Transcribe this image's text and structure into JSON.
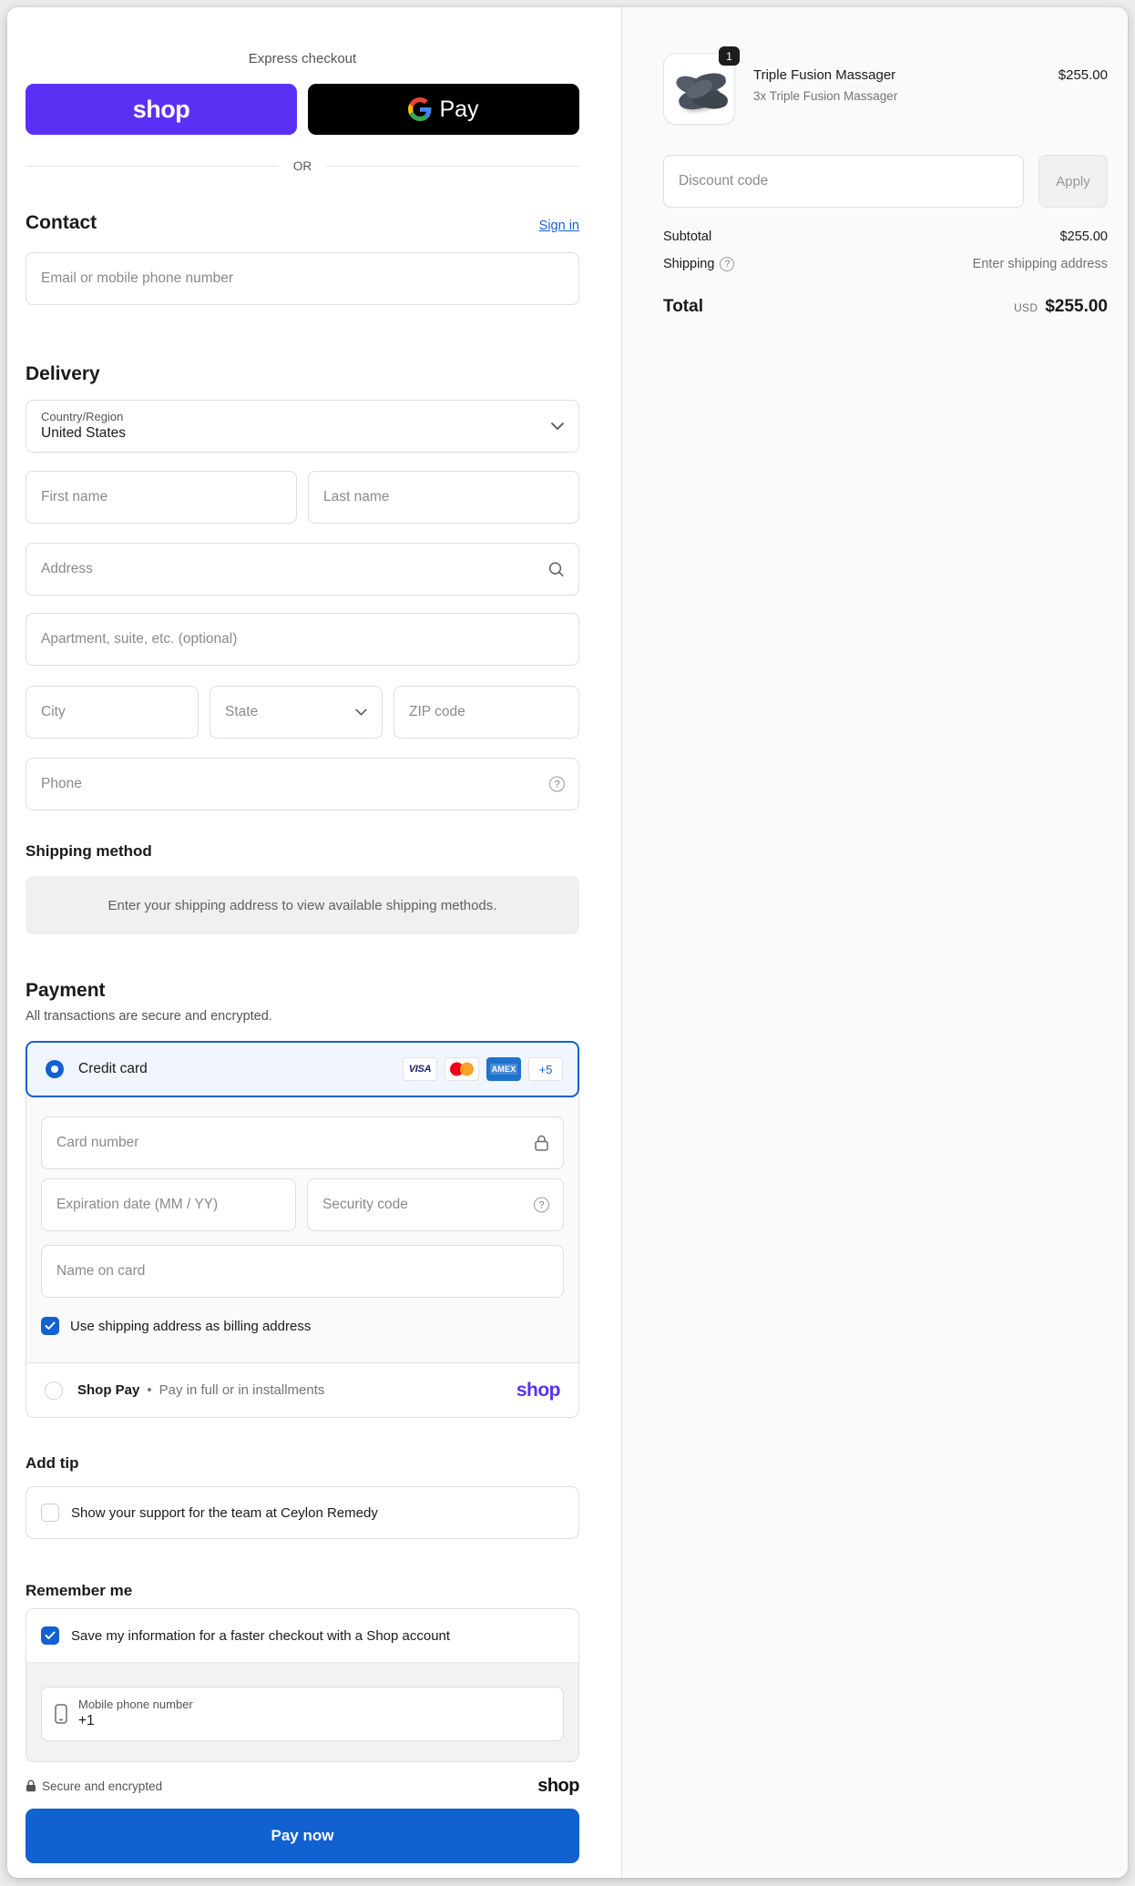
{
  "express": {
    "label": "Express checkout",
    "shop_button_label": "shop",
    "gpay_button_label": "Pay",
    "divider": "OR"
  },
  "contact": {
    "heading": "Contact",
    "signin_link": "Sign in",
    "email_placeholder": "Email or mobile phone number"
  },
  "delivery": {
    "heading": "Delivery",
    "country_label": "Country/Region",
    "country_value": "United States",
    "first_name_placeholder": "First name",
    "last_name_placeholder": "Last name",
    "address_placeholder": "Address",
    "apartment_placeholder": "Apartment, suite, etc. (optional)",
    "city_placeholder": "City",
    "state_placeholder": "State",
    "zip_placeholder": "ZIP code",
    "phone_placeholder": "Phone"
  },
  "shipping_method": {
    "heading": "Shipping method",
    "notice": "Enter your shipping address to view available shipping methods."
  },
  "payment": {
    "heading": "Payment",
    "subtitle": "All transactions are secure and encrypted.",
    "credit_card_label": "Credit card",
    "badges": {
      "visa": "VISA",
      "amex": "AMEX",
      "more": "+5"
    },
    "card_number_placeholder": "Card number",
    "expiration_placeholder": "Expiration date (MM / YY)",
    "security_code_placeholder": "Security code",
    "name_on_card_placeholder": "Name on card",
    "billing_checkbox_label": "Use shipping address as billing address",
    "shop_pay_label": "Shop Pay",
    "separator": "•",
    "shop_pay_desc": "Pay in full or in installments",
    "shop_logo": "shop"
  },
  "add_tip": {
    "heading": "Add tip",
    "checkbox_label": "Show your support for the team at Ceylon Remedy"
  },
  "remember": {
    "heading": "Remember me",
    "save_checkbox_label": "Save my information for a faster checkout with a Shop account",
    "phone_label": "Mobile phone number",
    "phone_value": "+1"
  },
  "footer": {
    "secure_label": "Secure and encrypted",
    "shop_logo": "shop",
    "pay_button_label": "Pay now"
  },
  "summary": {
    "item": {
      "quantity_badge": "1",
      "title": "Triple Fusion Massager",
      "price": "$255.00",
      "variant": "3x Triple Fusion Massager"
    },
    "discount": {
      "placeholder": "Discount code",
      "apply_label": "Apply"
    },
    "subtotal_label": "Subtotal",
    "subtotal_value": "$255.00",
    "shipping_label": "Shipping",
    "shipping_value": "Enter shipping address",
    "total_label": "Total",
    "currency": "USD",
    "total_value": "$255.00"
  },
  "icons": {
    "help_glyph": "?"
  },
  "colors": {
    "accent_blue": "#1261d1",
    "shop_purple": "#5a31f4",
    "pane_bg": "#fafafa"
  }
}
